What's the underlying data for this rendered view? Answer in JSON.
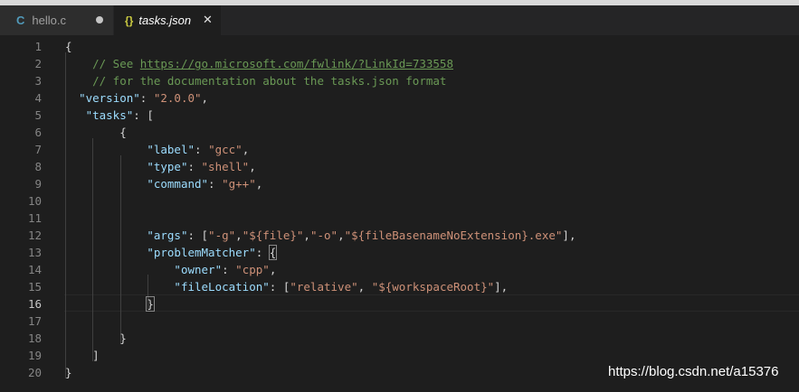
{
  "tabs": [
    {
      "icon": "C",
      "label": "hello.c",
      "state": "unsaved-dot"
    },
    {
      "icon": "{}",
      "label": "tasks.json",
      "state": "close"
    }
  ],
  "close_glyph": "✕",
  "active_line": 16,
  "lines": [
    {
      "num": "1",
      "parts": [
        {
          "t": "{"
        }
      ]
    },
    {
      "num": "2",
      "parts": [
        {
          "t": "    // See ",
          "c": "cm"
        },
        {
          "t": "https://go.microsoft.com/fwlink/?LinkId=733558",
          "c": "lnk"
        }
      ]
    },
    {
      "num": "3",
      "parts": [
        {
          "t": "    // for the documentation about the tasks.json format",
          "c": "cm"
        }
      ]
    },
    {
      "num": "4",
      "parts": [
        {
          "t": "  "
        },
        {
          "t": "\"version\"",
          "c": "k"
        },
        {
          "t": ": "
        },
        {
          "t": "\"2.0.0\"",
          "c": "s"
        },
        {
          "t": ","
        }
      ]
    },
    {
      "num": "5",
      "parts": [
        {
          "t": "   "
        },
        {
          "t": "\"tasks\"",
          "c": "k"
        },
        {
          "t": ": ["
        }
      ]
    },
    {
      "num": "6",
      "parts": [
        {
          "t": "        {"
        }
      ]
    },
    {
      "num": "7",
      "parts": [
        {
          "t": "            "
        },
        {
          "t": "\"label\"",
          "c": "k"
        },
        {
          "t": ": "
        },
        {
          "t": "\"gcc\"",
          "c": "s"
        },
        {
          "t": ","
        }
      ]
    },
    {
      "num": "8",
      "parts": [
        {
          "t": "            "
        },
        {
          "t": "\"type\"",
          "c": "k"
        },
        {
          "t": ": "
        },
        {
          "t": "\"shell\"",
          "c": "s"
        },
        {
          "t": ","
        }
      ]
    },
    {
      "num": "9",
      "parts": [
        {
          "t": "            "
        },
        {
          "t": "\"command\"",
          "c": "k"
        },
        {
          "t": ": "
        },
        {
          "t": "\"g++\"",
          "c": "s"
        },
        {
          "t": ","
        }
      ]
    },
    {
      "num": "10",
      "parts": []
    },
    {
      "num": "11",
      "parts": []
    },
    {
      "num": "12",
      "parts": [
        {
          "t": "            "
        },
        {
          "t": "\"args\"",
          "c": "k"
        },
        {
          "t": ": ["
        },
        {
          "t": "\"-g\"",
          "c": "s"
        },
        {
          "t": ","
        },
        {
          "t": "\"${file}\"",
          "c": "s"
        },
        {
          "t": ","
        },
        {
          "t": "\"-o\"",
          "c": "s"
        },
        {
          "t": ","
        },
        {
          "t": "\"${fileBasenameNoExtension}.exe\"",
          "c": "s"
        },
        {
          "t": "],"
        }
      ]
    },
    {
      "num": "13",
      "parts": [
        {
          "t": "            "
        },
        {
          "t": "\"problemMatcher\"",
          "c": "k"
        },
        {
          "t": ": "
        },
        {
          "t": "{",
          "c": "br"
        }
      ]
    },
    {
      "num": "14",
      "parts": [
        {
          "t": "                "
        },
        {
          "t": "\"owner\"",
          "c": "k"
        },
        {
          "t": ": "
        },
        {
          "t": "\"cpp\"",
          "c": "s"
        },
        {
          "t": ","
        }
      ]
    },
    {
      "num": "15",
      "parts": [
        {
          "t": "                "
        },
        {
          "t": "\"fileLocation\"",
          "c": "k"
        },
        {
          "t": ": ["
        },
        {
          "t": "\"relative\"",
          "c": "s"
        },
        {
          "t": ", "
        },
        {
          "t": "\"${workspaceRoot}\"",
          "c": "s"
        },
        {
          "t": "],"
        }
      ]
    },
    {
      "num": "16",
      "parts": [
        {
          "t": "            "
        },
        {
          "t": "}",
          "c": "br"
        }
      ]
    },
    {
      "num": "17",
      "parts": []
    },
    {
      "num": "18",
      "parts": [
        {
          "t": "        }"
        }
      ]
    },
    {
      "num": "19",
      "parts": [
        {
          "t": "    ]"
        }
      ]
    },
    {
      "num": "20",
      "parts": [
        {
          "t": "}"
        }
      ]
    }
  ],
  "watermark": "https://blog.csdn.net/a15376"
}
